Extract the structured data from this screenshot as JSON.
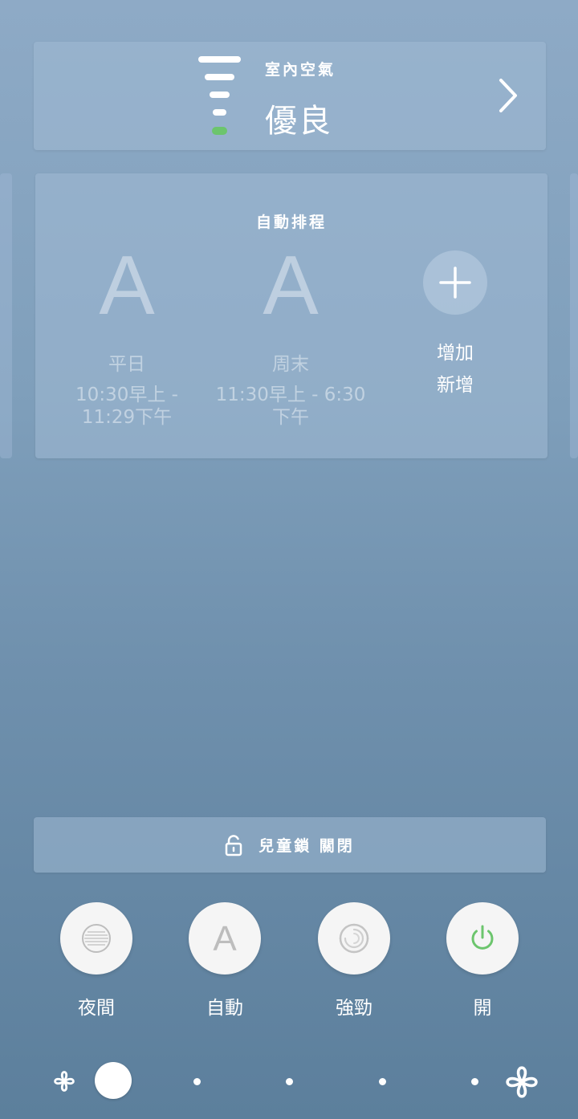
{
  "air_quality": {
    "title": "室內空氣",
    "value": "優良",
    "level_color": "#6cc56d"
  },
  "schedule": {
    "title": "自動排程",
    "items": [
      {
        "mode_letter": "A",
        "name": "平日",
        "time_line1": "10:30早上 -",
        "time_line2": "11:29下午"
      },
      {
        "mode_letter": "A",
        "name": "周末",
        "time_line1": "11:30早上 - 6:30",
        "time_line2": "下午"
      }
    ],
    "add": {
      "icon": "plus-icon",
      "label_line1": "增加",
      "label_line2": "新增"
    }
  },
  "child_lock": {
    "icon": "unlock-icon",
    "label": "兒童鎖 關閉"
  },
  "modes": [
    {
      "icon": "night-icon",
      "label": "夜間"
    },
    {
      "icon": "auto-icon",
      "label": "自動",
      "letter": "A"
    },
    {
      "icon": "turbo-icon",
      "label": "強勁"
    },
    {
      "icon": "power-icon",
      "label": "開",
      "color": "#6cc56d"
    }
  ],
  "fan_speed": {
    "min_icon": "fan-low-icon",
    "max_icon": "fan-high-icon",
    "steps": 5,
    "current_step": 1
  }
}
